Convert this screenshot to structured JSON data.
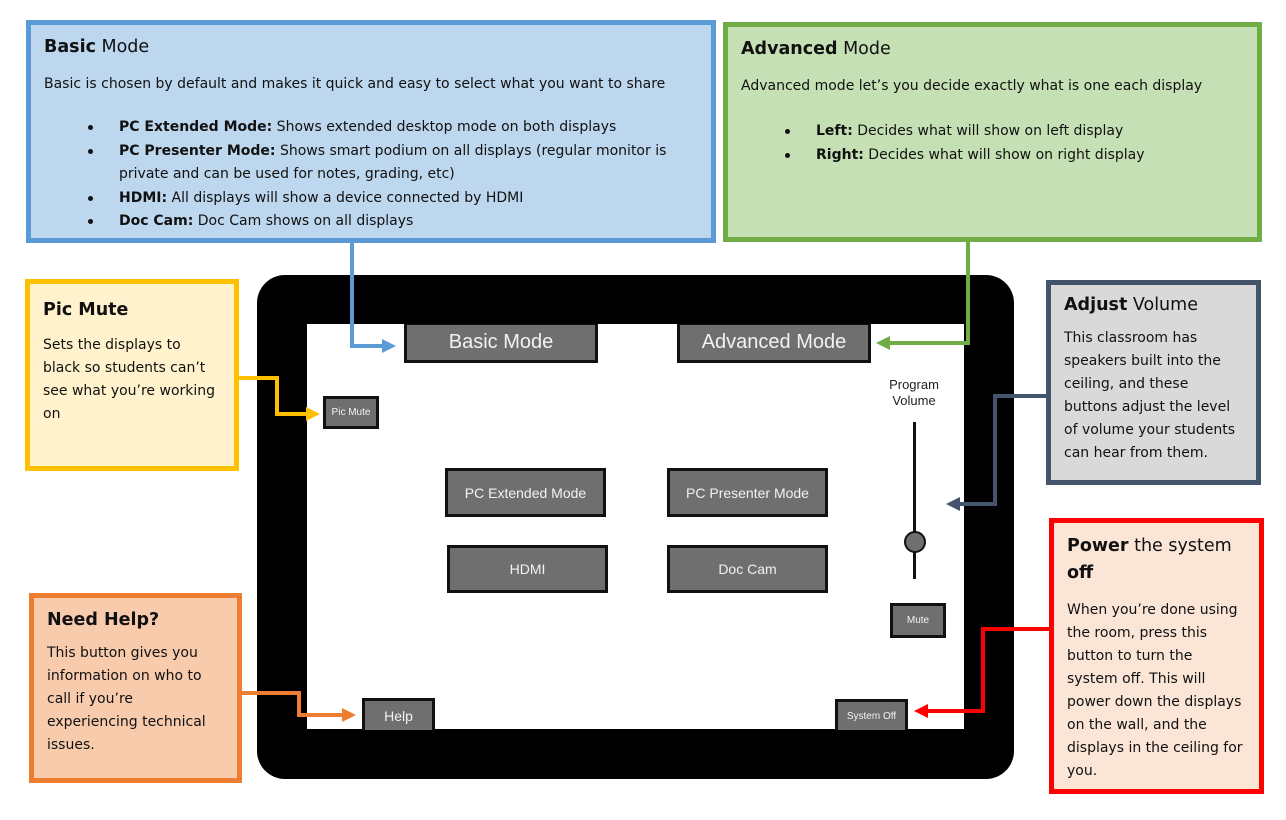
{
  "callouts": {
    "basic": {
      "title_bold": "Basic",
      "title_rest": " Mode",
      "intro": "Basic is chosen by default and makes it quick and easy to select what you want to share",
      "items": [
        {
          "term": "PC Extended Mode:",
          "desc": " Shows extended desktop mode on both displays"
        },
        {
          "term": "PC Presenter Mode:",
          "desc": " Shows smart podium on all displays (regular monitor is private and can be used for notes, grading, etc)"
        },
        {
          "term": "HDMI:",
          "desc": " All displays will show a device connected by HDMI"
        },
        {
          "term": "Doc Cam:",
          "desc": " Doc Cam shows on all displays"
        }
      ],
      "color": "#5b9bd5"
    },
    "advanced": {
      "title_bold": "Advanced",
      "title_rest": " Mode",
      "intro": "Advanced mode let’s you decide exactly what is one each display",
      "items": [
        {
          "term": "Left:",
          "desc": " Decides what will show on left display"
        },
        {
          "term": "Right:",
          "desc": " Decides what will show on right display"
        }
      ],
      "color": "#70ad47"
    },
    "pic_mute": {
      "title": "Pic Mute",
      "body": "Sets the displays to black so students can’t see what you’re working on",
      "color": "#ffc000"
    },
    "volume": {
      "title_bold": "Adjust",
      "title_rest": " Volume",
      "body": "This classroom has speakers built into the ceiling, and these buttons adjust the level of volume your students can hear from them.",
      "color": "#44546a"
    },
    "power": {
      "title_bold": "Power",
      "title_mid": " the system ",
      "title_bold2": "off",
      "body": "When you’re done using the room, press this button to turn the system off. This will power down the displays on the wall, and the displays in the ceiling for you.",
      "color": "#ff0000"
    },
    "help": {
      "title": "Need Help?",
      "body": "This button gives you information on who to call if you’re experiencing technical issues.",
      "color": "#ed7d31"
    }
  },
  "tablet": {
    "buttons": {
      "basic_mode": "Basic Mode",
      "advanced_mode": "Advanced Mode",
      "pic_mute": "Pic Mute",
      "pc_extended": "PC Extended Mode",
      "pc_presenter": "PC Presenter Mode",
      "hdmi": "HDMI",
      "doc_cam": "Doc Cam",
      "mute": "Mute",
      "help": "Help",
      "system_off": "System Off"
    },
    "volume": {
      "label_line1": "Program",
      "label_line2": "Volume",
      "level_fraction": 0.23
    }
  }
}
